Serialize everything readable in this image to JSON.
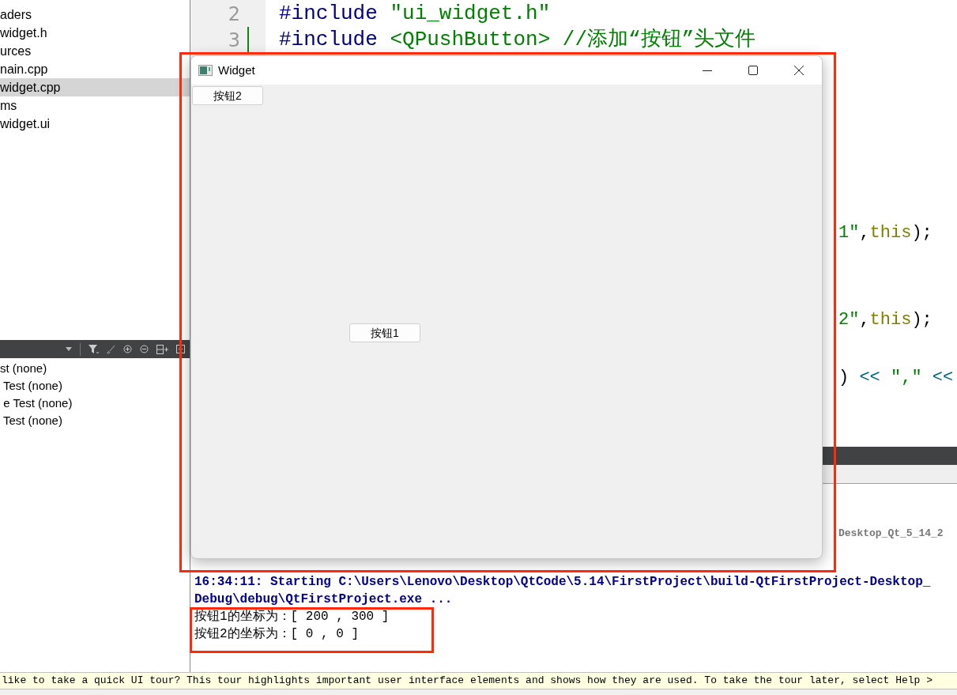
{
  "project_tree": {
    "items": [
      {
        "label": "aders",
        "selected": false
      },
      {
        "label": "widget.h",
        "selected": false
      },
      {
        "label": "urces",
        "selected": false
      },
      {
        "label": "nain.cpp",
        "selected": false
      },
      {
        "label": "widget.cpp",
        "selected": true
      },
      {
        "label": "ms",
        "selected": false
      },
      {
        "label": "widget.ui",
        "selected": false
      }
    ]
  },
  "tests_panel": {
    "items": [
      "st (none)",
      " Test (none)",
      " e Test (none)",
      " Test (none)"
    ]
  },
  "editor": {
    "lines": [
      {
        "number": "2",
        "modified": false,
        "tokens": [
          {
            "kind": "preprocessor",
            "text": "#include"
          },
          {
            "kind": "string",
            "text": " \"ui_widget.h\""
          }
        ]
      },
      {
        "number": "3",
        "modified": true,
        "tokens": [
          {
            "kind": "preprocessor",
            "text": "#include"
          },
          {
            "kind": "string",
            "text": " <QPushButton>"
          },
          {
            "kind": "comment",
            "text": " //添加“按钮”头文件"
          }
        ]
      }
    ],
    "fragments": [
      [
        {
          "kind": "string",
          "text": "1\""
        },
        {
          "kind": "plain",
          "text": ","
        },
        {
          "kind": "keyword",
          "text": "this"
        },
        {
          "kind": "plain",
          "text": ");"
        }
      ],
      [
        {
          "kind": "string",
          "text": "2\""
        },
        {
          "kind": "plain",
          "text": ","
        },
        {
          "kind": "keyword",
          "text": "this"
        },
        {
          "kind": "plain",
          "text": ");"
        }
      ],
      [
        {
          "kind": "plain",
          "text": ")"
        },
        {
          "kind": "operator",
          "text": " << "
        },
        {
          "kind": "string",
          "text": "\",\""
        },
        {
          "kind": "operator",
          "text": " <<"
        }
      ]
    ]
  },
  "compile_output": {
    "fragment": "Desktop_Qt_5_14_2"
  },
  "application_output": {
    "lines": [
      {
        "kind": "status",
        "text": "16:34:11: Starting C:\\Users\\Lenovo\\Desktop\\QtCode\\5.14\\FirstProject\\build-QtFirstProject-Desktop_"
      },
      {
        "kind": "status",
        "text": "Debug\\debug\\QtFirstProject.exe ..."
      },
      {
        "kind": "plain",
        "text": "按钮1的坐标为：[ 200 , 300 ]"
      },
      {
        "kind": "plain",
        "text": "按钮2的坐标为：[ 0 , 0 ]"
      }
    ]
  },
  "widget_window": {
    "title": "Widget",
    "buttons": [
      {
        "label": "按钮2"
      },
      {
        "label": "按钮1"
      }
    ]
  },
  "tour_bar": {
    "text": "like to take a quick UI tour? This tour highlights important user interface elements and shows how they are used. To take the tour later, select Help >"
  }
}
